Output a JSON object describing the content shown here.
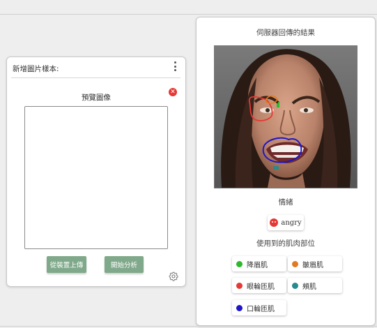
{
  "upload": {
    "title": "新增圖片樣本:",
    "preview_label": "預覽圖像",
    "close_icon": "✕",
    "upload_button": "從裝置上傳",
    "analyze_button": "開始分析"
  },
  "result": {
    "title": "伺服器回傳的結果",
    "emotion_label": "情緒",
    "emotion_value": "angry",
    "muscles_label": "使用到的肌肉部位",
    "muscles": [
      {
        "label": "降眉肌",
        "color": "#2eb82e"
      },
      {
        "label": "皺眉肌",
        "color": "#e07b24"
      },
      {
        "label": "眼輪匝肌",
        "color": "#e53935"
      },
      {
        "label": "頰肌",
        "color": "#268a8f"
      },
      {
        "label": "口輪匝肌",
        "color": "#1f16c8"
      }
    ]
  }
}
